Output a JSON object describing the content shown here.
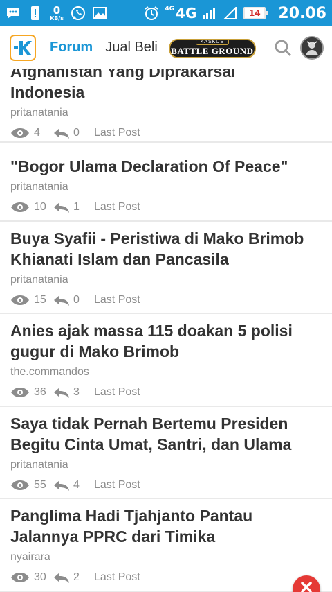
{
  "status_bar": {
    "speed_value": "0",
    "speed_unit": "KB/s",
    "network_small": "4G",
    "network_big": "4G",
    "battery": "14",
    "time": "20.06",
    "icons": [
      "chat-icon",
      "alert-icon",
      "whatsapp-icon",
      "gallery-icon",
      "alarm-icon",
      "signal-icon"
    ]
  },
  "header": {
    "logo_icon": "kaskus-logo-icon",
    "tab_forum": "Forum",
    "tab_jual_beli": "Jual Beli",
    "battleground_top": "KASKUS",
    "battleground_main": "BATTLE GROUND",
    "search_icon": "search-icon",
    "avatar_icon": "user-avatar",
    "accent_color": "#1a96d6"
  },
  "threads": [
    {
      "title_line1": "Afghanistan Yang Diprakarsai",
      "title_line2": "Indonesia",
      "author": "pritanatania",
      "views": "4",
      "replies": "0",
      "last_post": "Last Post"
    },
    {
      "title_line1": "\"Bogor Ulama Declaration Of Peace\"",
      "title_line2": "",
      "author": "pritanatania",
      "views": "10",
      "replies": "1",
      "last_post": "Last Post"
    },
    {
      "title_line1": "Buya Syafii - Peristiwa di Mako Brimob",
      "title_line2": "Khianati Islam dan Pancasila",
      "author": "pritanatania",
      "views": "15",
      "replies": "0",
      "last_post": "Last Post"
    },
    {
      "title_line1": "Anies ajak massa 115 doakan 5 polisi",
      "title_line2": "gugur di Mako Brimob",
      "author": "the.commandos",
      "views": "36",
      "replies": "3",
      "last_post": "Last Post"
    },
    {
      "title_line1": "Saya tidak Pernah Bertemu Presiden",
      "title_line2": "Begitu Cinta Umat, Santri, dan Ulama",
      "author": "pritanatania",
      "views": "55",
      "replies": "4",
      "last_post": "Last Post"
    },
    {
      "title_line1": "Panglima Hadi Tjahjanto Pantau",
      "title_line2": "Jalannya PPRC dari Timika",
      "author": "nyairara",
      "views": "30",
      "replies": "2",
      "last_post": "Last Post"
    }
  ],
  "close_button_color": "#e53935"
}
